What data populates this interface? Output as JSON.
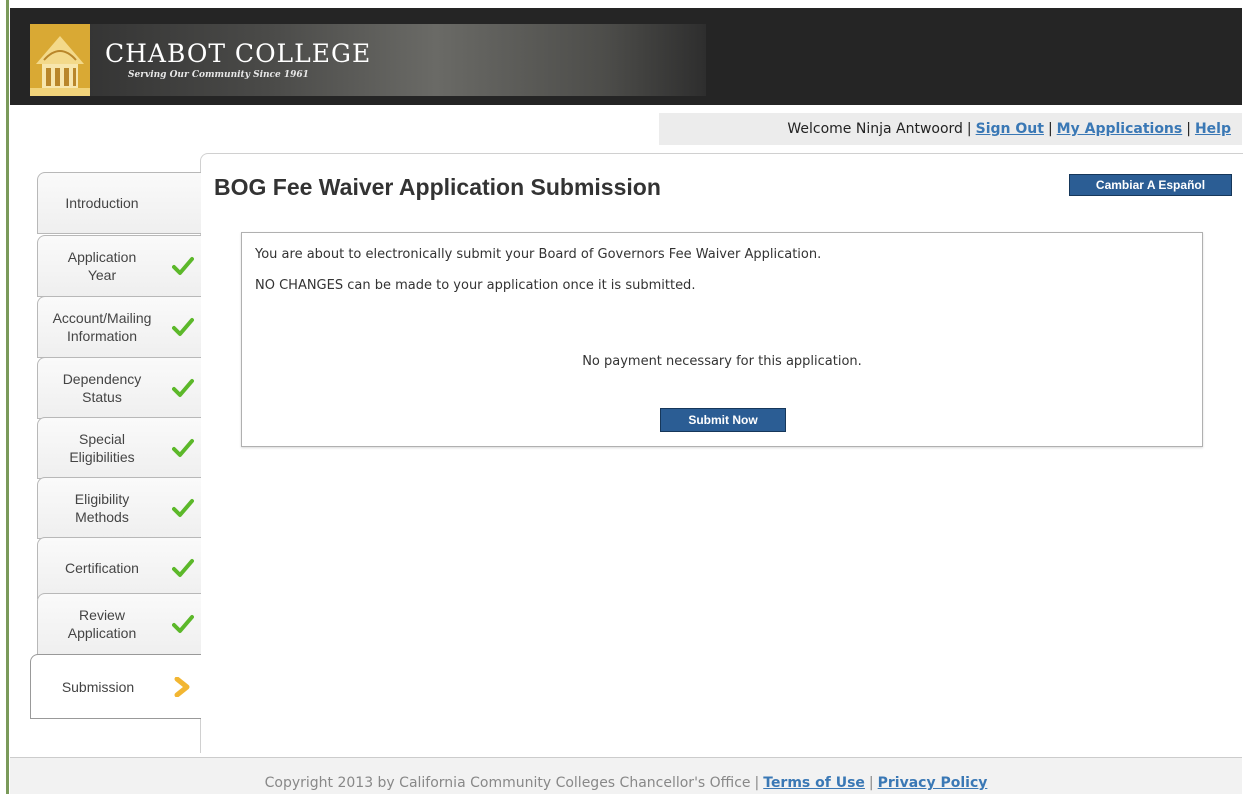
{
  "header": {
    "college_name": "CHABOT COLLEGE",
    "tagline": "Serving Our Community Since 1961",
    "logo_icon": "chabot-building-logo",
    "logo_color": "#d9a934"
  },
  "welcome_bar": {
    "welcome_text": "Welcome Ninja Antwoord",
    "separator": "|",
    "sign_out": "Sign Out",
    "my_applications": "My Applications",
    "help": "Help",
    "link_color": "#3a78b5"
  },
  "steps": [
    {
      "label": "Introduction",
      "status": "none"
    },
    {
      "label": "Application Year",
      "status": "complete",
      "icon": "checkmark-icon"
    },
    {
      "label": "Account/Mailing Information",
      "status": "complete",
      "icon": "checkmark-icon"
    },
    {
      "label": "Dependency Status",
      "status": "complete",
      "icon": "checkmark-icon"
    },
    {
      "label": "Special Eligibilities",
      "status": "complete",
      "icon": "checkmark-icon"
    },
    {
      "label": "Eligibility Methods",
      "status": "complete",
      "icon": "checkmark-icon"
    },
    {
      "label": "Certification",
      "status": "complete",
      "icon": "checkmark-icon"
    },
    {
      "label": "Review Application",
      "status": "complete",
      "icon": "checkmark-icon"
    },
    {
      "label": "Submission",
      "status": "current",
      "icon": "chevron-right-icon"
    }
  ],
  "main": {
    "title": "BOG Fee Waiver Application Submission",
    "language_button": "Cambiar A Español",
    "message_line1": "You are about to electronically submit your Board of Governors Fee Waiver Application.",
    "message_line2": "NO CHANGES can be made to your application once it is submitted.",
    "payment_note": "No payment necessary for this application.",
    "submit_button": "Submit Now",
    "button_color": "#2b5d94"
  },
  "footer": {
    "copyright": "Copyright 2013 by California Community Colleges Chancellor's Office",
    "separator": "|",
    "terms": "Terms of Use",
    "privacy": "Privacy Policy"
  },
  "colors": {
    "check_green": "#5cb82a",
    "current_arrow": "#f2b632",
    "header_bg": "#252525"
  }
}
